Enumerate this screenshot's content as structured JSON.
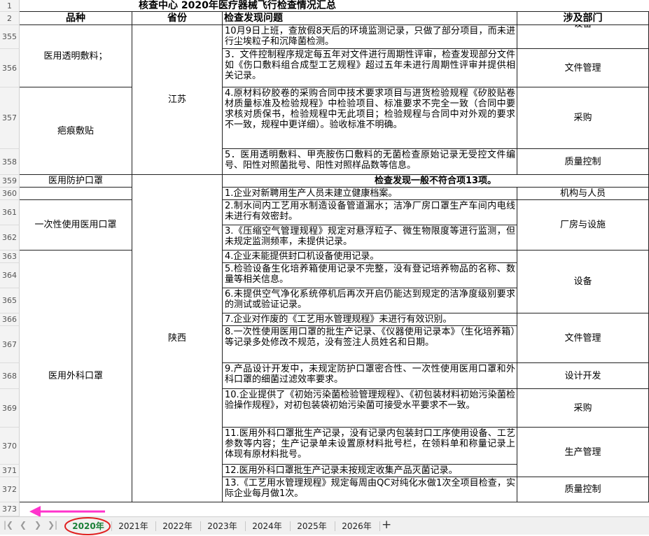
{
  "sheet_title": "核查中心  2020年医疗器械飞行检查情况汇总",
  "headers": {
    "product": "品种",
    "province": "省份",
    "issue": "检查发现问题",
    "dept": "涉及部门"
  },
  "row_numbers": [
    "2",
    "355",
    "356",
    "357",
    "358",
    "359",
    "360",
    "361",
    "362",
    "363",
    "364",
    "365",
    "366",
    "367",
    "368",
    "369",
    "370",
    "371",
    "372",
    "373"
  ],
  "products": {
    "p1": "医用透明敷料；",
    "p2": "疤痕敷贴",
    "p3": "医用防护口罩",
    "p4": "一次性使用医用口罩",
    "p5": "医用外科口罩"
  },
  "provinces": {
    "jiangsu": "江苏",
    "shaanxi": "陕西"
  },
  "issues": {
    "i355": "10月9日上班，查放假8天后的环境监测记录，只做了部分项目，而未进行尘埃粒子和沉降菌检测。",
    "i356": "3．文件控制程序规定每五年对文件进行周期性评审，检查发现部分文件如《伤口敷料组合成型工艺规程》超过五年未进行周期性评审并提供相关记录。",
    "i357": "4.原材料矽胶卷的采购合同中技术要求项目与进货检验规程《矽胶贴卷材质量标准及检验规程》中检验项目、标准要求不完全一致（合同中要求核对质保书，检验规程中无此项目；检验规程与合同中对外观的要求不一致，规程中更详细）。验收标准不明确。",
    "i358": "5．医用透明敷料、甲壳胺伤口敷料的无菌检查原始记录无受控文件编号、阳性对照菌批号、阳性对照样品数等信息。",
    "i359": "检查发现一般不符合项13项。",
    "i360": "1.企业对新聘用生产人员未建立健康档案。",
    "i361": "2.制水间内工艺用水制造设备管道漏水；洁净厂房口罩生产车间内电线未进行有效密封。",
    "i362": "3.《压缩空气管理规程》规定对悬浮粒子、微生物限度等进行监测，但未规定监测频率，未提供记录。",
    "i363": "4.企业未能提供封口机设备使用记录。",
    "i364": "5.检验设备生化培养箱使用记录不完整，没有登记培养物品的名称、数量等相关信息。",
    "i365": "6.未提供空气净化系统停机后再次开启仍能达到规定的洁净度级别要求的测试或验证记录。",
    "i366": "7.企业对作废的《工艺用水管理规程》未进行有效识别。",
    "i367": "8.一次性使用医用口罩的批生产记录、《仪器使用记录本》（生化培养箱）等记录多处修改不规范，没有签注人员姓名和日期。",
    "i368": "9.产品设计开发中，未规定防护口罩密合性、一次性使用医用口罩和外科口罩的细菌过滤效率要求。",
    "i369": "10.企业提供了《初始污染菌检验管理规程》、《初包装材料初始污染菌检验操作规程》，对初包装袋初始污染菌可接受水平要求不一致。",
    "i370": "11.医用外科口罩批生产记录，没有记录内包装封口工序使用设备、工艺参数等内容；生产记录单未设置原材料批号栏，在领料单和称量记录上体现有原材料批号。",
    "i371": "12.医用外科口罩批生产记录未按规定收集产品灭菌记录。",
    "i372": "13.《工艺用水管理规程》规定每周由QC对纯化水做1次全项目检查，实际企业每月做1次。"
  },
  "depts": {
    "d355": "设备",
    "d356": "文件管理",
    "d357": "采购",
    "d358": "质量控制",
    "d360": "机构与人员",
    "d361": "厂房与设施",
    "d363": "设备",
    "d366": "文件管理",
    "d368": "设计开发",
    "d369": "采购",
    "d370": "生产管理",
    "d372": "质量控制"
  },
  "sheet_tabs": [
    "2020年",
    "2021年",
    "2022年",
    "2023年",
    "2024年",
    "2025年",
    "2026年"
  ],
  "active_tab": "2020年",
  "colors": {
    "active_tab_text": "#1a7f37",
    "annotation_circle": "#e02020",
    "annotation_arrow": "#ff33cc"
  },
  "icons": [
    "first-sheet-icon",
    "prev-sheet-icon",
    "next-sheet-icon",
    "last-sheet-icon",
    "add-sheet-icon"
  ]
}
